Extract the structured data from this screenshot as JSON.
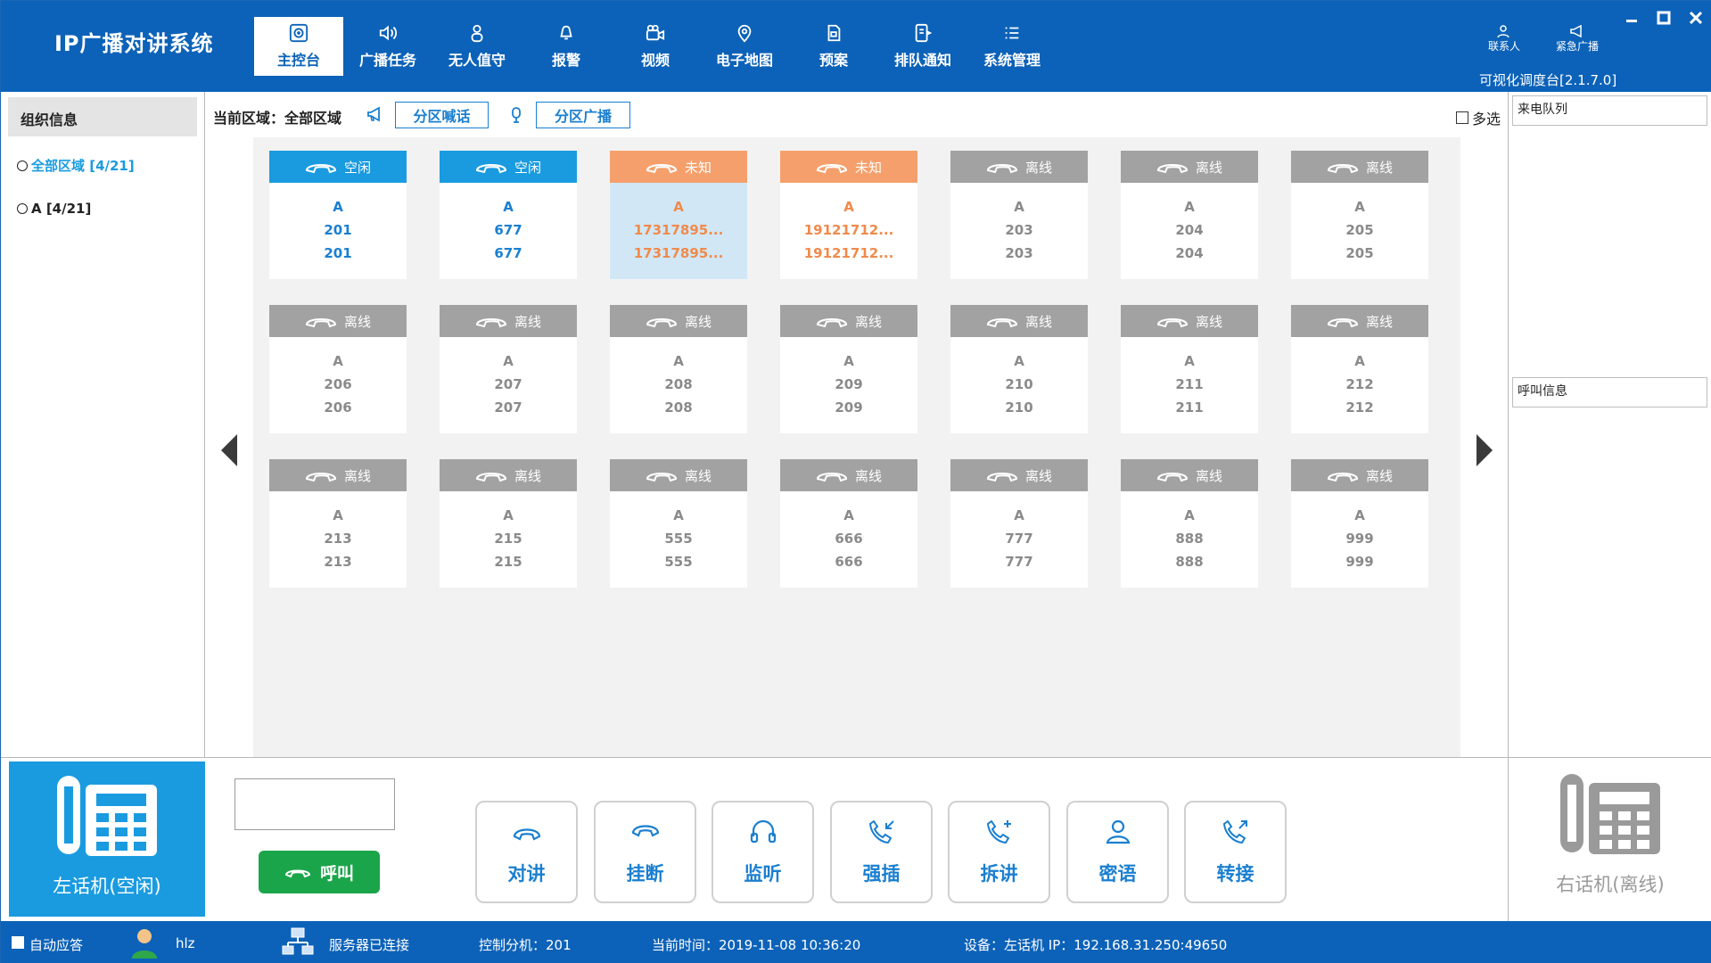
{
  "app": {
    "title": "IP广播对讲系统",
    "version": "可视化调度台[2.1.7.0]"
  },
  "nav": [
    {
      "label": "主控台",
      "icon": "console-icon"
    },
    {
      "label": "广播任务",
      "icon": "speaker-icon"
    },
    {
      "label": "无人值守",
      "icon": "person-icon"
    },
    {
      "label": "报警",
      "icon": "alarm-icon"
    },
    {
      "label": "视频",
      "icon": "video-icon"
    },
    {
      "label": "电子地图",
      "icon": "map-pin-icon"
    },
    {
      "label": "预案",
      "icon": "plan-icon"
    },
    {
      "label": "排队通知",
      "icon": "queue-icon"
    },
    {
      "label": "系统管理",
      "icon": "list-icon"
    }
  ],
  "header": {
    "contacts": "联系人",
    "emergency": "紧急广播"
  },
  "sidebar": {
    "title": "组织信息",
    "items": [
      {
        "label": "全部区域 [4/21]"
      },
      {
        "label": "A [4/21]"
      }
    ]
  },
  "toolbar": {
    "area_label": "当前区域：全部区域",
    "zone_talk": "分区喊话",
    "zone_broadcast": "分区广播",
    "multi_select": "多选"
  },
  "status_labels": {
    "idle": "空闲",
    "unknown": "未知",
    "offline": "离线"
  },
  "terminals": [
    {
      "status": "idle",
      "label": "空闲",
      "area": "A",
      "line1": "201",
      "line2": "201"
    },
    {
      "status": "idle",
      "label": "空闲",
      "area": "A",
      "line1": "677",
      "line2": "677"
    },
    {
      "status": "unknown",
      "label": "未知",
      "area": "A",
      "line1": "17317895...",
      "line2": "17317895...",
      "selected": true
    },
    {
      "status": "unknown",
      "label": "未知",
      "area": "A",
      "line1": "19121712...",
      "line2": "19121712..."
    },
    {
      "status": "offline",
      "label": "离线",
      "area": "A",
      "line1": "203",
      "line2": "203"
    },
    {
      "status": "offline",
      "label": "离线",
      "area": "A",
      "line1": "204",
      "line2": "204"
    },
    {
      "status": "offline",
      "label": "离线",
      "area": "A",
      "line1": "205",
      "line2": "205"
    },
    {
      "status": "offline",
      "label": "离线",
      "area": "A",
      "line1": "206",
      "line2": "206"
    },
    {
      "status": "offline",
      "label": "离线",
      "area": "A",
      "line1": "207",
      "line2": "207"
    },
    {
      "status": "offline",
      "label": "离线",
      "area": "A",
      "line1": "208",
      "line2": "208"
    },
    {
      "status": "offline",
      "label": "离线",
      "area": "A",
      "line1": "209",
      "line2": "209"
    },
    {
      "status": "offline",
      "label": "离线",
      "area": "A",
      "line1": "210",
      "line2": "210"
    },
    {
      "status": "offline",
      "label": "离线",
      "area": "A",
      "line1": "211",
      "line2": "211"
    },
    {
      "status": "offline",
      "label": "离线",
      "area": "A",
      "line1": "212",
      "line2": "212"
    },
    {
      "status": "offline",
      "label": "离线",
      "area": "A",
      "line1": "213",
      "line2": "213"
    },
    {
      "status": "offline",
      "label": "离线",
      "area": "A",
      "line1": "215",
      "line2": "215"
    },
    {
      "status": "offline",
      "label": "离线",
      "area": "A",
      "line1": "555",
      "line2": "555"
    },
    {
      "status": "offline",
      "label": "离线",
      "area": "A",
      "line1": "666",
      "line2": "666"
    },
    {
      "status": "offline",
      "label": "离线",
      "area": "A",
      "line1": "777",
      "line2": "777"
    },
    {
      "status": "offline",
      "label": "离线",
      "area": "A",
      "line1": "888",
      "line2": "888"
    },
    {
      "status": "offline",
      "label": "离线",
      "area": "A",
      "line1": "999",
      "line2": "999"
    }
  ],
  "right_panel": {
    "incoming_queue": "来电队列",
    "call_info": "呼叫信息"
  },
  "controls": {
    "left_phone": "左话机(空闲)",
    "right_phone": "右话机(离线)",
    "dial_value": "",
    "call": "呼叫",
    "actions": [
      {
        "label": "对讲",
        "icon": "handset-icon"
      },
      {
        "label": "挂断",
        "icon": "hangup-icon"
      },
      {
        "label": "监听",
        "icon": "headset-icon"
      },
      {
        "label": "强插",
        "icon": "barge-in-icon"
      },
      {
        "label": "拆讲",
        "icon": "split-call-icon"
      },
      {
        "label": "密语",
        "icon": "whisper-icon"
      },
      {
        "label": "转接",
        "icon": "transfer-icon"
      }
    ]
  },
  "statusbar": {
    "auto_answer": "自动应答",
    "user": "hlz",
    "server": "服务器已连接",
    "control_ext": "控制分机：201",
    "current_time": "当前时间：2019-11-08 10:36:20",
    "device": "设备：左话机 IP：192.168.31.250:49650"
  },
  "colors": {
    "header": "#0c62b8",
    "idle": "#1a9be0",
    "unknown": "#f5a06c",
    "offline": "#a2a2a2",
    "call": "#1aa54a"
  }
}
